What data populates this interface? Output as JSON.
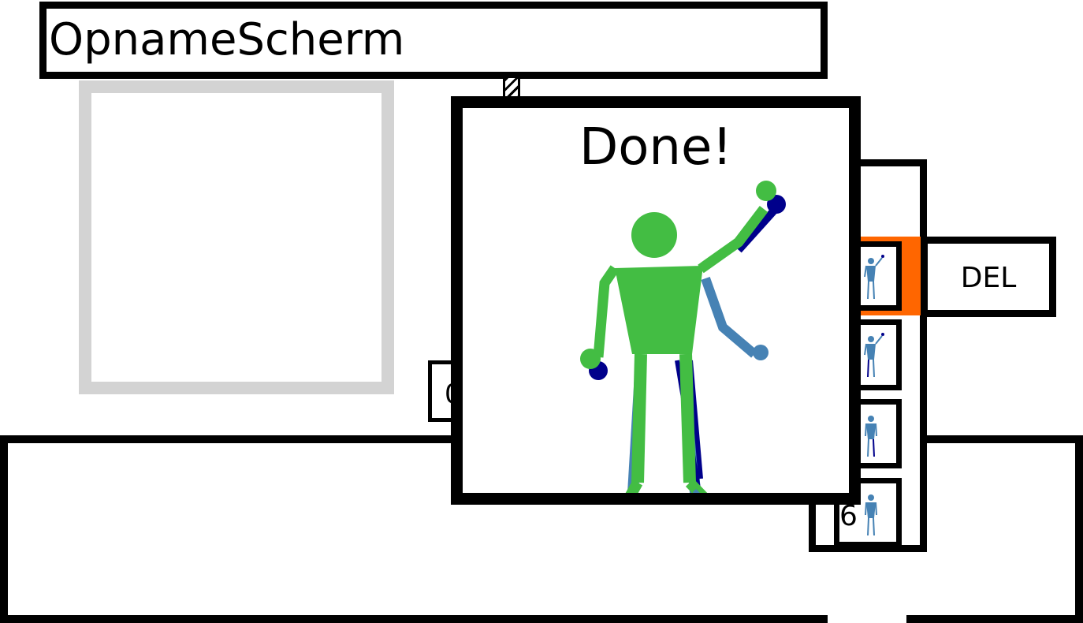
{
  "window": {
    "title": "OpnameScherm"
  },
  "recording": {
    "hidden_button_label": "0"
  },
  "recordings_list": {
    "last_item_number": "6",
    "delete_label": "DEL"
  },
  "dialog": {
    "title": "Done!"
  },
  "colors": {
    "accent_selected": "#ff6600",
    "pose_target": "#43bd43",
    "pose_actual": "#4682b4",
    "pose_shadow": "#00008b",
    "preview_frame": "#d3d3d3"
  },
  "icons": [
    "stick-figure-icon"
  ]
}
